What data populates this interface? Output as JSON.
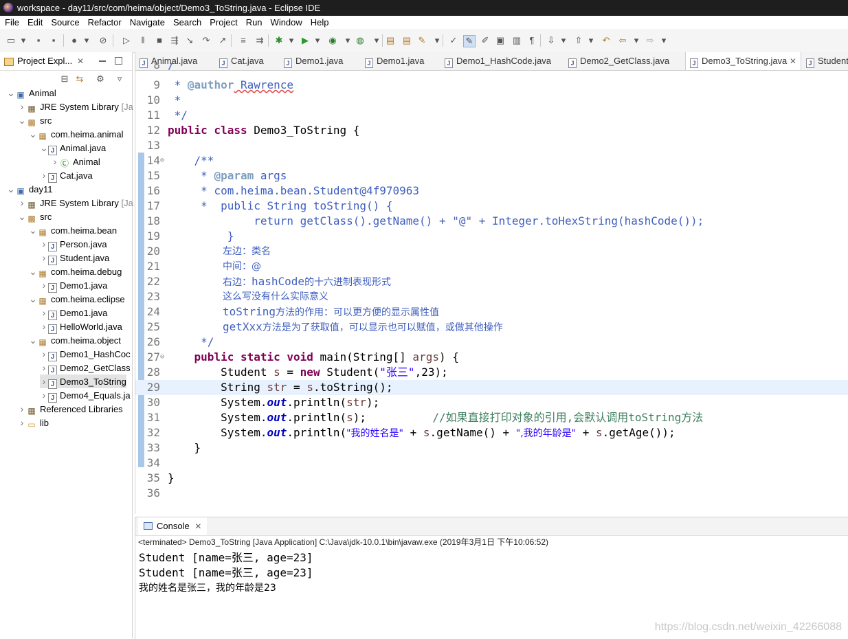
{
  "window": {
    "title": "workspace - day11/src/com/heima/object/Demo3_ToString.java - Eclipse IDE"
  },
  "menu": [
    "File",
    "Edit",
    "Source",
    "Refactor",
    "Navigate",
    "Search",
    "Project",
    "Run",
    "Window",
    "Help"
  ],
  "explorer": {
    "tab_label": "Project Expl...",
    "tree": [
      {
        "label": "Animal",
        "icon": "project-icon",
        "indent": 0,
        "twisty": "v"
      },
      {
        "label": "JRE System Library",
        "suffix": " [Ja",
        "icon": "library-icon",
        "indent": 1,
        "twisty": ">"
      },
      {
        "label": "src",
        "icon": "source-folder-icon",
        "indent": 1,
        "twisty": "v"
      },
      {
        "label": "com.heima.animal",
        "icon": "package-icon",
        "indent": 2,
        "twisty": "v"
      },
      {
        "label": "Animal.java",
        "icon": "java-file-icon",
        "indent": 3,
        "twisty": "v"
      },
      {
        "label": "Animal",
        "icon": "class-icon",
        "indent": 4,
        "twisty": ">"
      },
      {
        "label": "Cat.java",
        "icon": "java-file-icon",
        "indent": 3,
        "twisty": ">"
      },
      {
        "label": "day11",
        "icon": "project-icon",
        "indent": 0,
        "twisty": "v"
      },
      {
        "label": "JRE System Library",
        "suffix": " [Ja",
        "icon": "library-icon",
        "indent": 1,
        "twisty": ">"
      },
      {
        "label": "src",
        "icon": "source-folder-icon",
        "indent": 1,
        "twisty": "v"
      },
      {
        "label": "com.heima.bean",
        "icon": "package-icon",
        "indent": 2,
        "twisty": "v"
      },
      {
        "label": "Person.java",
        "icon": "java-file-icon",
        "indent": 3,
        "twisty": ">"
      },
      {
        "label": "Student.java",
        "icon": "java-file-icon",
        "indent": 3,
        "twisty": ">"
      },
      {
        "label": "com.heima.debug",
        "icon": "package-icon",
        "indent": 2,
        "twisty": "v"
      },
      {
        "label": "Demo1.java",
        "icon": "java-file-icon",
        "indent": 3,
        "twisty": ">"
      },
      {
        "label": "com.heima.eclipse",
        "icon": "package-icon",
        "indent": 2,
        "twisty": "v"
      },
      {
        "label": "Demo1.java",
        "icon": "java-file-icon",
        "indent": 3,
        "twisty": ">"
      },
      {
        "label": "HelloWorld.java",
        "icon": "java-file-icon",
        "indent": 3,
        "twisty": ">"
      },
      {
        "label": "com.heima.object",
        "icon": "package-icon",
        "indent": 2,
        "twisty": "v"
      },
      {
        "label": "Demo1_HashCoc",
        "icon": "java-file-icon",
        "indent": 3,
        "twisty": ">"
      },
      {
        "label": "Demo2_GetClass",
        "icon": "java-file-icon",
        "indent": 3,
        "twisty": ">"
      },
      {
        "label": "Demo3_ToString",
        "icon": "java-file-icon",
        "indent": 3,
        "twisty": ">",
        "selected": true
      },
      {
        "label": "Demo4_Equals.ja",
        "icon": "java-file-icon",
        "indent": 3,
        "twisty": ">"
      },
      {
        "label": "Referenced Libraries",
        "icon": "library-icon",
        "indent": 1,
        "twisty": ">"
      },
      {
        "label": "lib",
        "icon": "folder-icon",
        "indent": 1,
        "twisty": ">"
      }
    ]
  },
  "editor_tabs": [
    "Animal.java",
    "Cat.java",
    "Demo1.java",
    "Demo1.java",
    "Demo1_HashCode.java",
    "Demo2_GetClass.java",
    "Demo3_ToString.java",
    "Student.java"
  ],
  "active_tab_index": 6,
  "code": {
    "l8": "/",
    "l9_pre": " * ",
    "l9_tag": "@author",
    "l9_post": " Rawrence",
    "l10": " *",
    "l11": " */",
    "l12_kw": "public class",
    "l12_rest": " Demo3_ToString {",
    "l14": "    /**",
    "l15_pre": "     * ",
    "l15_tag": "@param",
    "l15_post": " args",
    "l16": "     * com.heima.bean.Student@4f970963",
    "l17": "     *  public String toString() {",
    "l18": "             return getClass().getName() + \"@\" + Integer.toHexString(hashCode());",
    "l19": "         }",
    "l20": "左边：类名",
    "l21": "中间：@",
    "l22_a": "右边：",
    "l22_b": "hashCode",
    "l22_c": "的十六进制表现形式",
    "l23": "这么写没有什么实际意义",
    "l24_a": "toString",
    "l24_b": "方法的作用：可以更方便的显示属性值",
    "l25_a": "getXxx",
    "l25_b": "方法是为了获取值，可以显示也可以赋值，或做其他操作",
    "l26": "     */",
    "l27_kw": "public static void",
    "l27_mid": " main(String[] ",
    "l27_var": "args",
    "l27_end": ") {",
    "l28_a": "        Student ",
    "l28_var": "s",
    "l28_b": " = ",
    "l28_kw": "new",
    "l28_c": " Student(",
    "l28_str": "\"张三\"",
    "l28_d": ",23);",
    "l29_a": "        String ",
    "l29_var": "str",
    "l29_b": " = ",
    "l29_var2": "s",
    "l29_c": ".toString();",
    "l30_a": "        System.",
    "l30_fld": "out",
    "l30_b": ".println(",
    "l30_var": "str",
    "l30_c": ");",
    "l31_a": "        System.",
    "l31_fld": "out",
    "l31_b": ".println(",
    "l31_var": "s",
    "l31_c": ");          ",
    "l31_cm": "//如果直接打印对象的引用,会默认调用toString方法",
    "l32_a": "        System.",
    "l32_fld": "out",
    "l32_b": ".println(",
    "l32_str1": "\"我的姓名是\"",
    "l32_c": " + ",
    "l32_var": "s",
    "l32_d": ".getName() + ",
    "l32_str2": "\",我的年龄是\"",
    "l32_e": " + ",
    "l32_var2": "s",
    "l32_f": ".getAge());",
    "l33": "    }",
    "l35": "}"
  },
  "console": {
    "tab_label": "Console",
    "status": "<terminated> Demo3_ToString [Java Application] C:\\Java\\jdk-10.0.1\\bin\\javaw.exe (2019年3月1日 下午10:06:52)",
    "lines": [
      "Student [name=张三, age=23]",
      "Student [name=张三, age=23]",
      "我的姓名是张三，我的年龄是23"
    ]
  },
  "watermark": "https://blog.csdn.net/weixin_42266088"
}
